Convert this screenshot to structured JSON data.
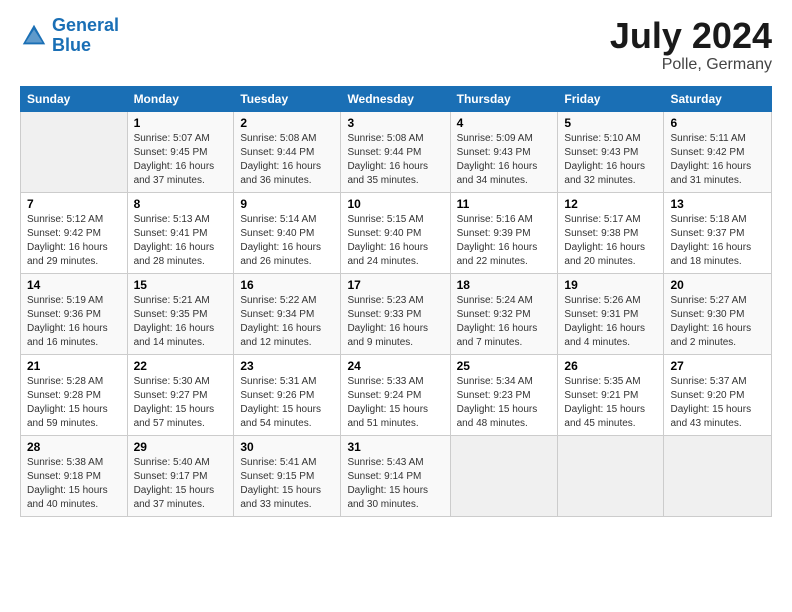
{
  "header": {
    "logo_line1": "General",
    "logo_line2": "Blue",
    "month_title": "July 2024",
    "location": "Polle, Germany"
  },
  "columns": [
    "Sunday",
    "Monday",
    "Tuesday",
    "Wednesday",
    "Thursday",
    "Friday",
    "Saturday"
  ],
  "weeks": [
    [
      {
        "day": "",
        "detail": ""
      },
      {
        "day": "1",
        "detail": "Sunrise: 5:07 AM\nSunset: 9:45 PM\nDaylight: 16 hours\nand 37 minutes."
      },
      {
        "day": "2",
        "detail": "Sunrise: 5:08 AM\nSunset: 9:44 PM\nDaylight: 16 hours\nand 36 minutes."
      },
      {
        "day": "3",
        "detail": "Sunrise: 5:08 AM\nSunset: 9:44 PM\nDaylight: 16 hours\nand 35 minutes."
      },
      {
        "day": "4",
        "detail": "Sunrise: 5:09 AM\nSunset: 9:43 PM\nDaylight: 16 hours\nand 34 minutes."
      },
      {
        "day": "5",
        "detail": "Sunrise: 5:10 AM\nSunset: 9:43 PM\nDaylight: 16 hours\nand 32 minutes."
      },
      {
        "day": "6",
        "detail": "Sunrise: 5:11 AM\nSunset: 9:42 PM\nDaylight: 16 hours\nand 31 minutes."
      }
    ],
    [
      {
        "day": "7",
        "detail": "Sunrise: 5:12 AM\nSunset: 9:42 PM\nDaylight: 16 hours\nand 29 minutes."
      },
      {
        "day": "8",
        "detail": "Sunrise: 5:13 AM\nSunset: 9:41 PM\nDaylight: 16 hours\nand 28 minutes."
      },
      {
        "day": "9",
        "detail": "Sunrise: 5:14 AM\nSunset: 9:40 PM\nDaylight: 16 hours\nand 26 minutes."
      },
      {
        "day": "10",
        "detail": "Sunrise: 5:15 AM\nSunset: 9:40 PM\nDaylight: 16 hours\nand 24 minutes."
      },
      {
        "day": "11",
        "detail": "Sunrise: 5:16 AM\nSunset: 9:39 PM\nDaylight: 16 hours\nand 22 minutes."
      },
      {
        "day": "12",
        "detail": "Sunrise: 5:17 AM\nSunset: 9:38 PM\nDaylight: 16 hours\nand 20 minutes."
      },
      {
        "day": "13",
        "detail": "Sunrise: 5:18 AM\nSunset: 9:37 PM\nDaylight: 16 hours\nand 18 minutes."
      }
    ],
    [
      {
        "day": "14",
        "detail": "Sunrise: 5:19 AM\nSunset: 9:36 PM\nDaylight: 16 hours\nand 16 minutes."
      },
      {
        "day": "15",
        "detail": "Sunrise: 5:21 AM\nSunset: 9:35 PM\nDaylight: 16 hours\nand 14 minutes."
      },
      {
        "day": "16",
        "detail": "Sunrise: 5:22 AM\nSunset: 9:34 PM\nDaylight: 16 hours\nand 12 minutes."
      },
      {
        "day": "17",
        "detail": "Sunrise: 5:23 AM\nSunset: 9:33 PM\nDaylight: 16 hours\nand 9 minutes."
      },
      {
        "day": "18",
        "detail": "Sunrise: 5:24 AM\nSunset: 9:32 PM\nDaylight: 16 hours\nand 7 minutes."
      },
      {
        "day": "19",
        "detail": "Sunrise: 5:26 AM\nSunset: 9:31 PM\nDaylight: 16 hours\nand 4 minutes."
      },
      {
        "day": "20",
        "detail": "Sunrise: 5:27 AM\nSunset: 9:30 PM\nDaylight: 16 hours\nand 2 minutes."
      }
    ],
    [
      {
        "day": "21",
        "detail": "Sunrise: 5:28 AM\nSunset: 9:28 PM\nDaylight: 15 hours\nand 59 minutes."
      },
      {
        "day": "22",
        "detail": "Sunrise: 5:30 AM\nSunset: 9:27 PM\nDaylight: 15 hours\nand 57 minutes."
      },
      {
        "day": "23",
        "detail": "Sunrise: 5:31 AM\nSunset: 9:26 PM\nDaylight: 15 hours\nand 54 minutes."
      },
      {
        "day": "24",
        "detail": "Sunrise: 5:33 AM\nSunset: 9:24 PM\nDaylight: 15 hours\nand 51 minutes."
      },
      {
        "day": "25",
        "detail": "Sunrise: 5:34 AM\nSunset: 9:23 PM\nDaylight: 15 hours\nand 48 minutes."
      },
      {
        "day": "26",
        "detail": "Sunrise: 5:35 AM\nSunset: 9:21 PM\nDaylight: 15 hours\nand 45 minutes."
      },
      {
        "day": "27",
        "detail": "Sunrise: 5:37 AM\nSunset: 9:20 PM\nDaylight: 15 hours\nand 43 minutes."
      }
    ],
    [
      {
        "day": "28",
        "detail": "Sunrise: 5:38 AM\nSunset: 9:18 PM\nDaylight: 15 hours\nand 40 minutes."
      },
      {
        "day": "29",
        "detail": "Sunrise: 5:40 AM\nSunset: 9:17 PM\nDaylight: 15 hours\nand 37 minutes."
      },
      {
        "day": "30",
        "detail": "Sunrise: 5:41 AM\nSunset: 9:15 PM\nDaylight: 15 hours\nand 33 minutes."
      },
      {
        "day": "31",
        "detail": "Sunrise: 5:43 AM\nSunset: 9:14 PM\nDaylight: 15 hours\nand 30 minutes."
      },
      {
        "day": "",
        "detail": ""
      },
      {
        "day": "",
        "detail": ""
      },
      {
        "day": "",
        "detail": ""
      }
    ]
  ]
}
